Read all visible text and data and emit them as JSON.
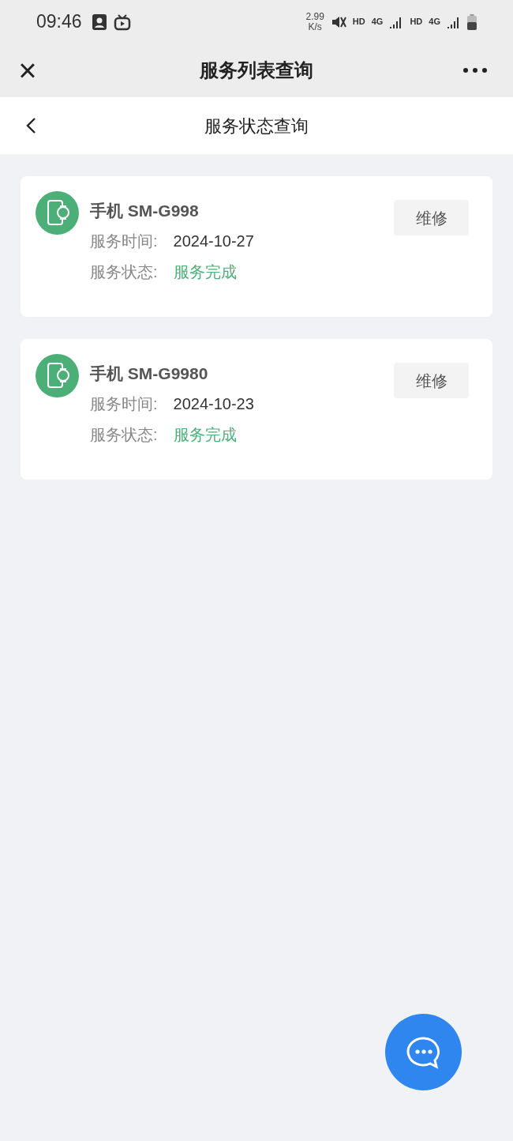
{
  "status_bar": {
    "time": "09:46",
    "network_speed": [
      "2.99",
      "K/s"
    ],
    "network_labels": [
      "HD",
      "4G",
      "HD",
      "4G"
    ]
  },
  "app_bar": {
    "close": "×",
    "title": "服务列表查询"
  },
  "page_header": {
    "title": "服务状态查询"
  },
  "records": [
    {
      "device": "手机 SM-G998",
      "time_label": "服务时间:",
      "time": "2024-10-27",
      "status_label": "服务状态:",
      "status": "服务完成",
      "action": "维修"
    },
    {
      "device": "手机 SM-G9980",
      "time_label": "服务时间:",
      "time": "2024-10-23",
      "status_label": "服务状态:",
      "status": "服务完成",
      "action": "维修"
    }
  ]
}
